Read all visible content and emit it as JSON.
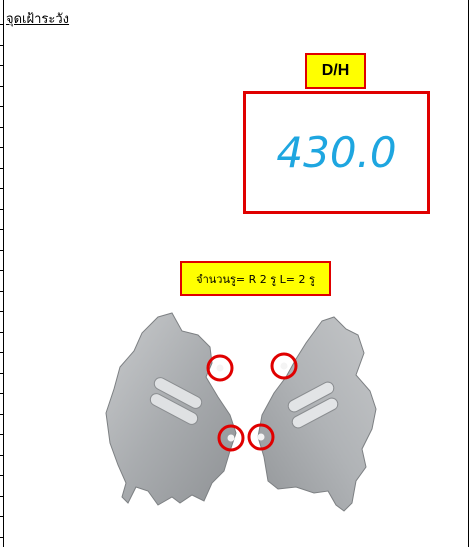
{
  "sheet": {
    "title": "จุดเฝ้าระวัง",
    "measurement": {
      "label": "D/H",
      "value": "430.0"
    },
    "hole_count_note": "จำนวนรู= R 2 รู   L= 2 รู"
  },
  "colors": {
    "highlight_fill": "#ffff00",
    "highlight_border": "#e00000",
    "value_text": "#1ea6e0"
  },
  "photo": {
    "marked_holes": 4
  }
}
